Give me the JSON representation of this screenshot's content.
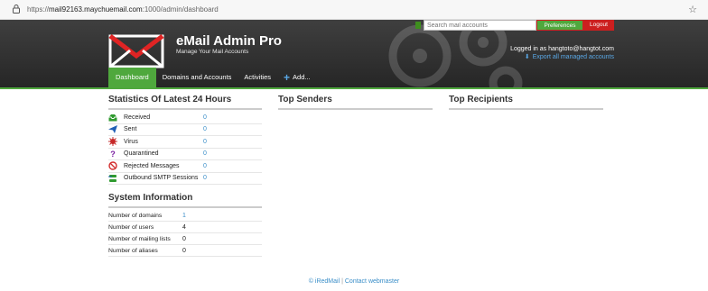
{
  "browser": {
    "url_scheme": "https://",
    "url_host": "mail92163.maychuemail.com",
    "url_path": ":1000/admin/dashboard"
  },
  "header": {
    "brand_title": "eMail Admin Pro",
    "brand_subtitle": "Manage Your Mail Accounts",
    "search_placeholder": "Search mail accounts",
    "preferences_label": "Preferences",
    "logout_label": "Logout",
    "logged_in_text": "Logged in as hangtoto@hangtot.com",
    "export_text": "Export all managed accounts"
  },
  "nav": {
    "items": [
      "Dashboard",
      "Domains and Accounts",
      "Activities"
    ],
    "add_label": "Add..."
  },
  "stats": {
    "title": "Statistics Of Latest 24 Hours",
    "rows": [
      {
        "label": "Received",
        "value": "0",
        "icon": "received-icon"
      },
      {
        "label": "Sent",
        "value": "0",
        "icon": "sent-icon"
      },
      {
        "label": "Virus",
        "value": "0",
        "icon": "virus-icon"
      },
      {
        "label": "Quarantined",
        "value": "0",
        "icon": "quarantine-icon"
      },
      {
        "label": "Rejected Messages",
        "value": "0",
        "icon": "rejected-icon"
      },
      {
        "label": "Outbound SMTP Sessions",
        "value": "0",
        "icon": "smtp-icon"
      }
    ]
  },
  "top_senders": {
    "title": "Top Senders"
  },
  "top_recipients": {
    "title": "Top Recipients"
  },
  "system": {
    "title": "System Information",
    "rows": [
      {
        "label": "Number of domains",
        "value": "1",
        "color": "#3a8ec8"
      },
      {
        "label": "Number of users",
        "value": "4",
        "color": "#222222"
      },
      {
        "label": "Number of mailing lists",
        "value": "0",
        "color": "#222222"
      },
      {
        "label": "Number of aliases",
        "value": "0",
        "color": "#222222"
      }
    ]
  },
  "footer": {
    "brand": "© iRedMail",
    "separator": "|",
    "contact": "Contact webmaster"
  },
  "colors": {
    "accent_green": "#4fa83d",
    "logout_red": "#cc1f1f",
    "link_blue": "#3a8ec8",
    "header_dark": "#2e2e2e"
  }
}
